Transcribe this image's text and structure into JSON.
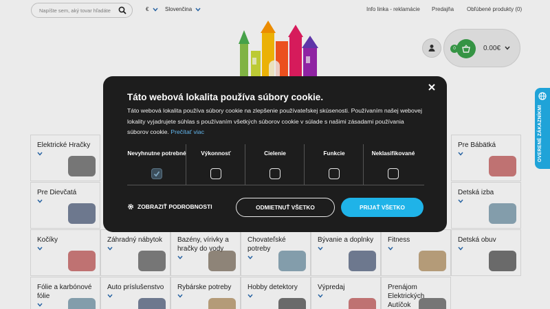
{
  "header": {
    "search_placeholder": "Napíšte sem, aký tovar hľadáte",
    "search_icon": "search-icon",
    "currency": "€",
    "language": "Slovenčina",
    "links": [
      "Info linka - reklamácie",
      "Predajňa",
      "Obľúbené produkty (0)"
    ],
    "cart": {
      "count": "0",
      "total": "0.00€"
    }
  },
  "categories": [
    [
      "Elektrické Hračky",
      "",
      "",
      "",
      "",
      "",
      "Pre Bábätká"
    ],
    [
      "Pre Dievčatá",
      "",
      "",
      "",
      "",
      "",
      "Detská izba"
    ],
    [
      "Kočíky",
      "Záhradný nábytok",
      "Bazény, vírivky a hračky do vody",
      "Chovateľské potreby",
      "Bývanie a doplnky",
      "Fitness",
      "Detská obuv"
    ],
    [
      "Fólie a karbónové fólie",
      "Auto príslušenstvo",
      "Rybárske potreby",
      "Hobby detektory",
      "Výpredaj",
      "Prenájom Elektrických Autíčok",
      ""
    ]
  ],
  "cookie": {
    "title": "Táto webová lokalita používa súbory cookie.",
    "description": "Táto webová lokalita používa súbory cookie na zlepšenie používateľskej skúsenosti. Používaním našej webovej lokality vyjadrujete súhlas s používaním všetkých súborov cookie v súlade s našimi zásadami používania súborov cookie.",
    "read_more": "Prečítať viac",
    "categories": [
      {
        "label": "Nevyhnutne potrebné",
        "checked": true
      },
      {
        "label": "Výkonnosť",
        "checked": false
      },
      {
        "label": "Cielenie",
        "checked": false
      },
      {
        "label": "Funkcie",
        "checked": false
      },
      {
        "label": "Neklasifikované",
        "checked": false
      }
    ],
    "show_details": "ZOBRAZIŤ PODROBNOSTI",
    "reject_all": "ODMIETNUŤ VŠETKO",
    "accept_all": "PRIJAŤ VŠETKO"
  },
  "side_tab": {
    "label": "OVERENÉ ZÁKAZNÍKMI"
  },
  "colors": {
    "accent": "#1fb3e8",
    "dialog_bg": "#1d1d1d",
    "cart_green": "#3aa14a"
  }
}
